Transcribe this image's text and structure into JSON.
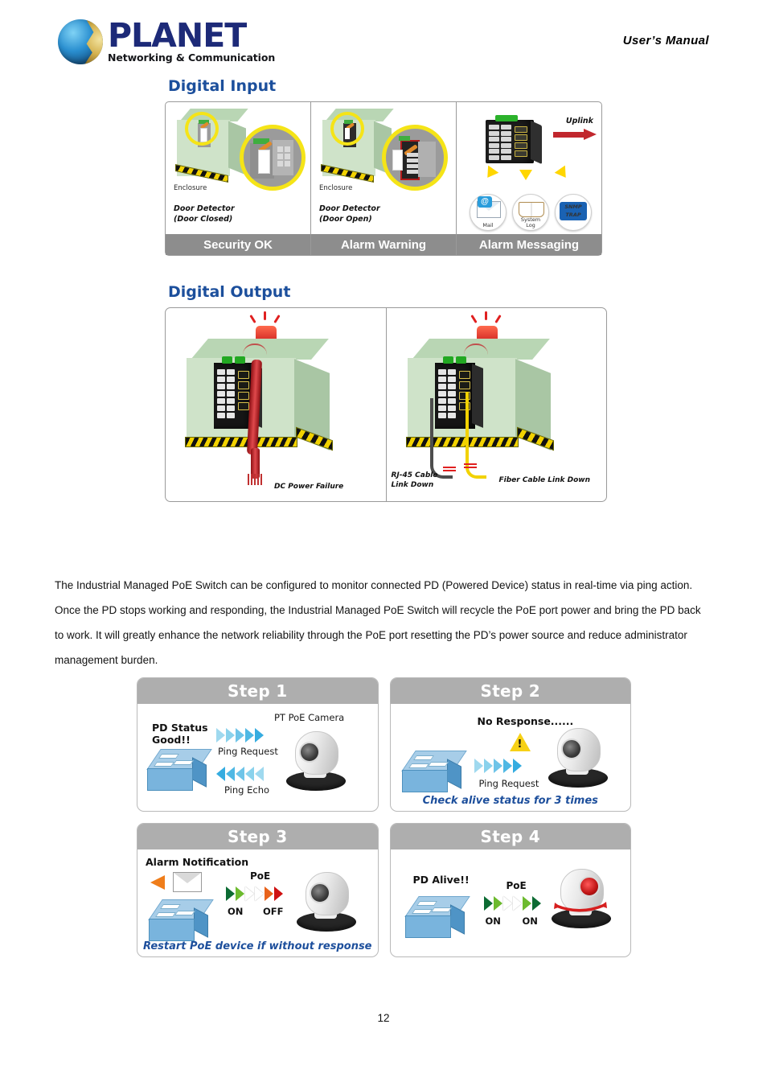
{
  "header": {
    "logo_brand": "PLANET",
    "logo_tagline": "Networking & Communication",
    "manual_label": "User’s  Manual"
  },
  "digital_input": {
    "title": "Digital Input",
    "panels": [
      {
        "enclosure_label": "Enclosure",
        "detector_line1": "Door Detector",
        "detector_line2": "(Door Closed)",
        "footer": "Security OK"
      },
      {
        "enclosure_label": "Enclosure",
        "detector_line1": "Door Detector",
        "detector_line2": "(Door Open)",
        "footer": "Alarm Warning"
      },
      {
        "uplink_label": "Uplink",
        "icons": [
          {
            "name": "mail-icon",
            "label": "Mail",
            "glyph": "@"
          },
          {
            "name": "system-log-icon",
            "label_line1": "System",
            "label_line2": "Log"
          },
          {
            "name": "snmp-trap-icon",
            "label_line1": "SNMP",
            "label_line2": "TRAP"
          }
        ],
        "footer": "Alarm Messaging"
      }
    ]
  },
  "digital_output": {
    "title": "Digital Output",
    "panels": [
      {
        "label": "DC Power Failure"
      },
      {
        "label_left_line1": "RJ-45 Cable",
        "label_left_line2": "Link Down",
        "label_right": "Fiber Cable Link Down"
      }
    ]
  },
  "body_paragraph": "The Industrial Managed PoE Switch can be configured to monitor connected PD (Powered Device) status in real-time via ping action. Once the PD stops working and responding, the Industrial Managed PoE Switch will recycle the PoE port power and bring the PD back to work. It will greatly enhance the network reliability through the PoE port resetting the PD’s power source and reduce administrator management burden.",
  "steps": [
    {
      "header": "Step 1",
      "status_line1": "PD Status",
      "status_line2": "Good!!",
      "device_label": "PT PoE Camera",
      "arrow_label_top": "Ping Request",
      "arrow_label_bottom": "Ping Echo"
    },
    {
      "header": "Step 2",
      "status": "No Response......",
      "arrow_label": "Ping Request",
      "caption": "Check alive status for 3 times"
    },
    {
      "header": "Step 3",
      "status": "Alarm Notification",
      "poe_label": "PoE",
      "state_left": "ON",
      "state_right": "OFF",
      "caption": "Restart PoE device if without response"
    },
    {
      "header": "Step 4",
      "status": "PD Alive!!",
      "poe_label": "PoE",
      "state_left": "ON",
      "state_right": "ON"
    }
  ],
  "page_number": "12",
  "colors": {
    "heading_blue": "#1c4f9c",
    "footer_gray": "#8d8d8d",
    "step_header_gray": "#aeaeae",
    "caption_blue": "#1d4f9c",
    "alert_yellow": "#f7d117",
    "uplink_red": "#c1272d"
  }
}
